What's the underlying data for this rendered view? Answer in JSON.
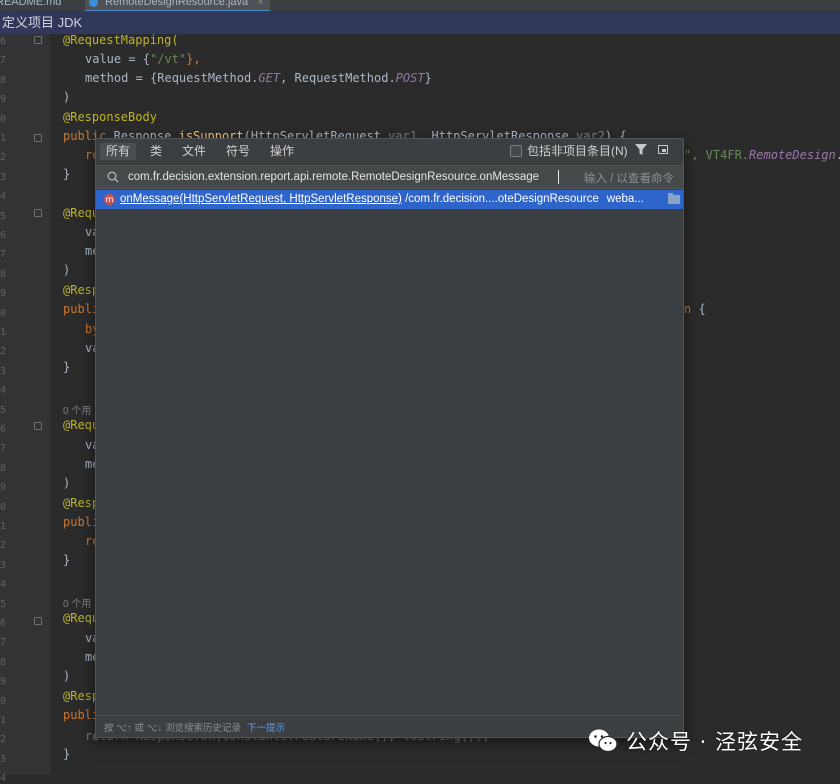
{
  "tabs": [
    {
      "label": "README.md"
    },
    {
      "label": "RemoteDesignResource.java"
    }
  ],
  "notice": "定义项目 JDK",
  "line_numbers": [
    "6",
    "7",
    "8",
    "9",
    "0",
    "1",
    "2",
    "3",
    "4",
    "5",
    "6",
    "7",
    "8",
    "9",
    "0",
    "1",
    "2",
    "3",
    "4",
    "5",
    "6",
    "7",
    "8",
    "9",
    "0",
    "1",
    "2",
    "3",
    "4",
    "5",
    "6",
    "7",
    "8",
    "9",
    "0",
    "1",
    "2",
    "3",
    "4"
  ],
  "code": {
    "l1": "@RequestMapping(",
    "l2_a": "value = {",
    "l2_str": "\"/vt\"",
    "l2_b": "},",
    "l3_a": "method = {RequestMethod.",
    "l3_get": "GET",
    "l3_b": ", RequestMethod.",
    "l3_post": "POST",
    "l3_c": "}",
    "l4": ")",
    "l5": "@ResponseBody",
    "l6_kw": "public",
    "l6_a": " Response ",
    "l6_fn": "isSupport",
    "l6_b": "(HttpServletRequest ",
    "l6_v1": "var1",
    "l6_c": ", HttpServletResponse ",
    "l6_v2": "var2",
    "l6_d": ") {",
    "l7_kw": "re",
    "l7_tail_a": "\", VT4FR.",
    "l7_tail_it": "RemoteDesign",
    "l7_tail_b": ".",
    "brace_close": "}",
    "ann_req": "@Requ",
    "ann_resp": "@Resp",
    "publi": "publi",
    "va": "va",
    "me": "me",
    "by": "by",
    "re": "re",
    "l15_tail_a": "n",
    "l15_tail_b": " {",
    "usage": "0 个用",
    "last_line": "return Response.ok(Constants.FeatureName(), toString());"
  },
  "popup": {
    "tabs": [
      "所有",
      "类",
      "文件",
      "符号",
      "操作"
    ],
    "include_non_project": "包括非项目条目(N)",
    "search_value": "com.fr.decision.extension.report.api.remote.RemoteDesignResource.onMessage",
    "search_hint": "输入 / 以查看命令",
    "result": {
      "icon": "m",
      "signature": "onMessage(HttpServletRequest, HttpServletResponse)",
      "path": " /com.fr.decision....oteDesignResource",
      "module": "weba..."
    },
    "footer": "按 ⌥↑ 或 ⌥↓ 浏览搜索历史记录",
    "footer_link": "下一提示"
  },
  "watermark": "公众号 · 泾弦安全"
}
